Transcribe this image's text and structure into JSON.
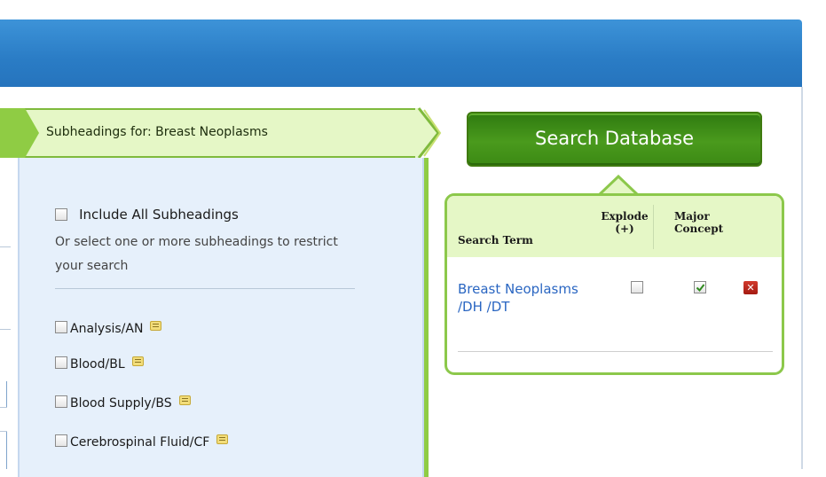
{
  "subheadings": {
    "title": "Subheadings for: Breast Neoplasms",
    "include_all_label": "Include All Subheadings",
    "hint": "Or select one or more subheadings to restrict your search",
    "items": [
      {
        "label": "Analysis/AN"
      },
      {
        "label": "Blood/BL"
      },
      {
        "label": "Blood Supply/BS"
      },
      {
        "label": "Cerebrospinal Fluid/CF"
      }
    ]
  },
  "search_button": {
    "label": "Search Database"
  },
  "search_builder": {
    "headers": {
      "term": "Search Term",
      "explode_line1": "Explode",
      "explode_line2": "(+)",
      "major_line1": "Major",
      "major_line2": "Concept"
    },
    "rows": [
      {
        "term": "Breast Neoplasms /DH /DT",
        "explode": false,
        "major_concept": true
      }
    ]
  },
  "colors": {
    "header_blue": "#2a7cc5",
    "banner_green": "#8fcc44",
    "button_green": "#4a9a1d",
    "panel_blue": "#e6f0fb",
    "link_blue": "#2a66c2",
    "delete_red": "#b8241a"
  },
  "icons": {
    "note": "note-icon",
    "delete": "delete-icon",
    "check": "check-icon"
  }
}
